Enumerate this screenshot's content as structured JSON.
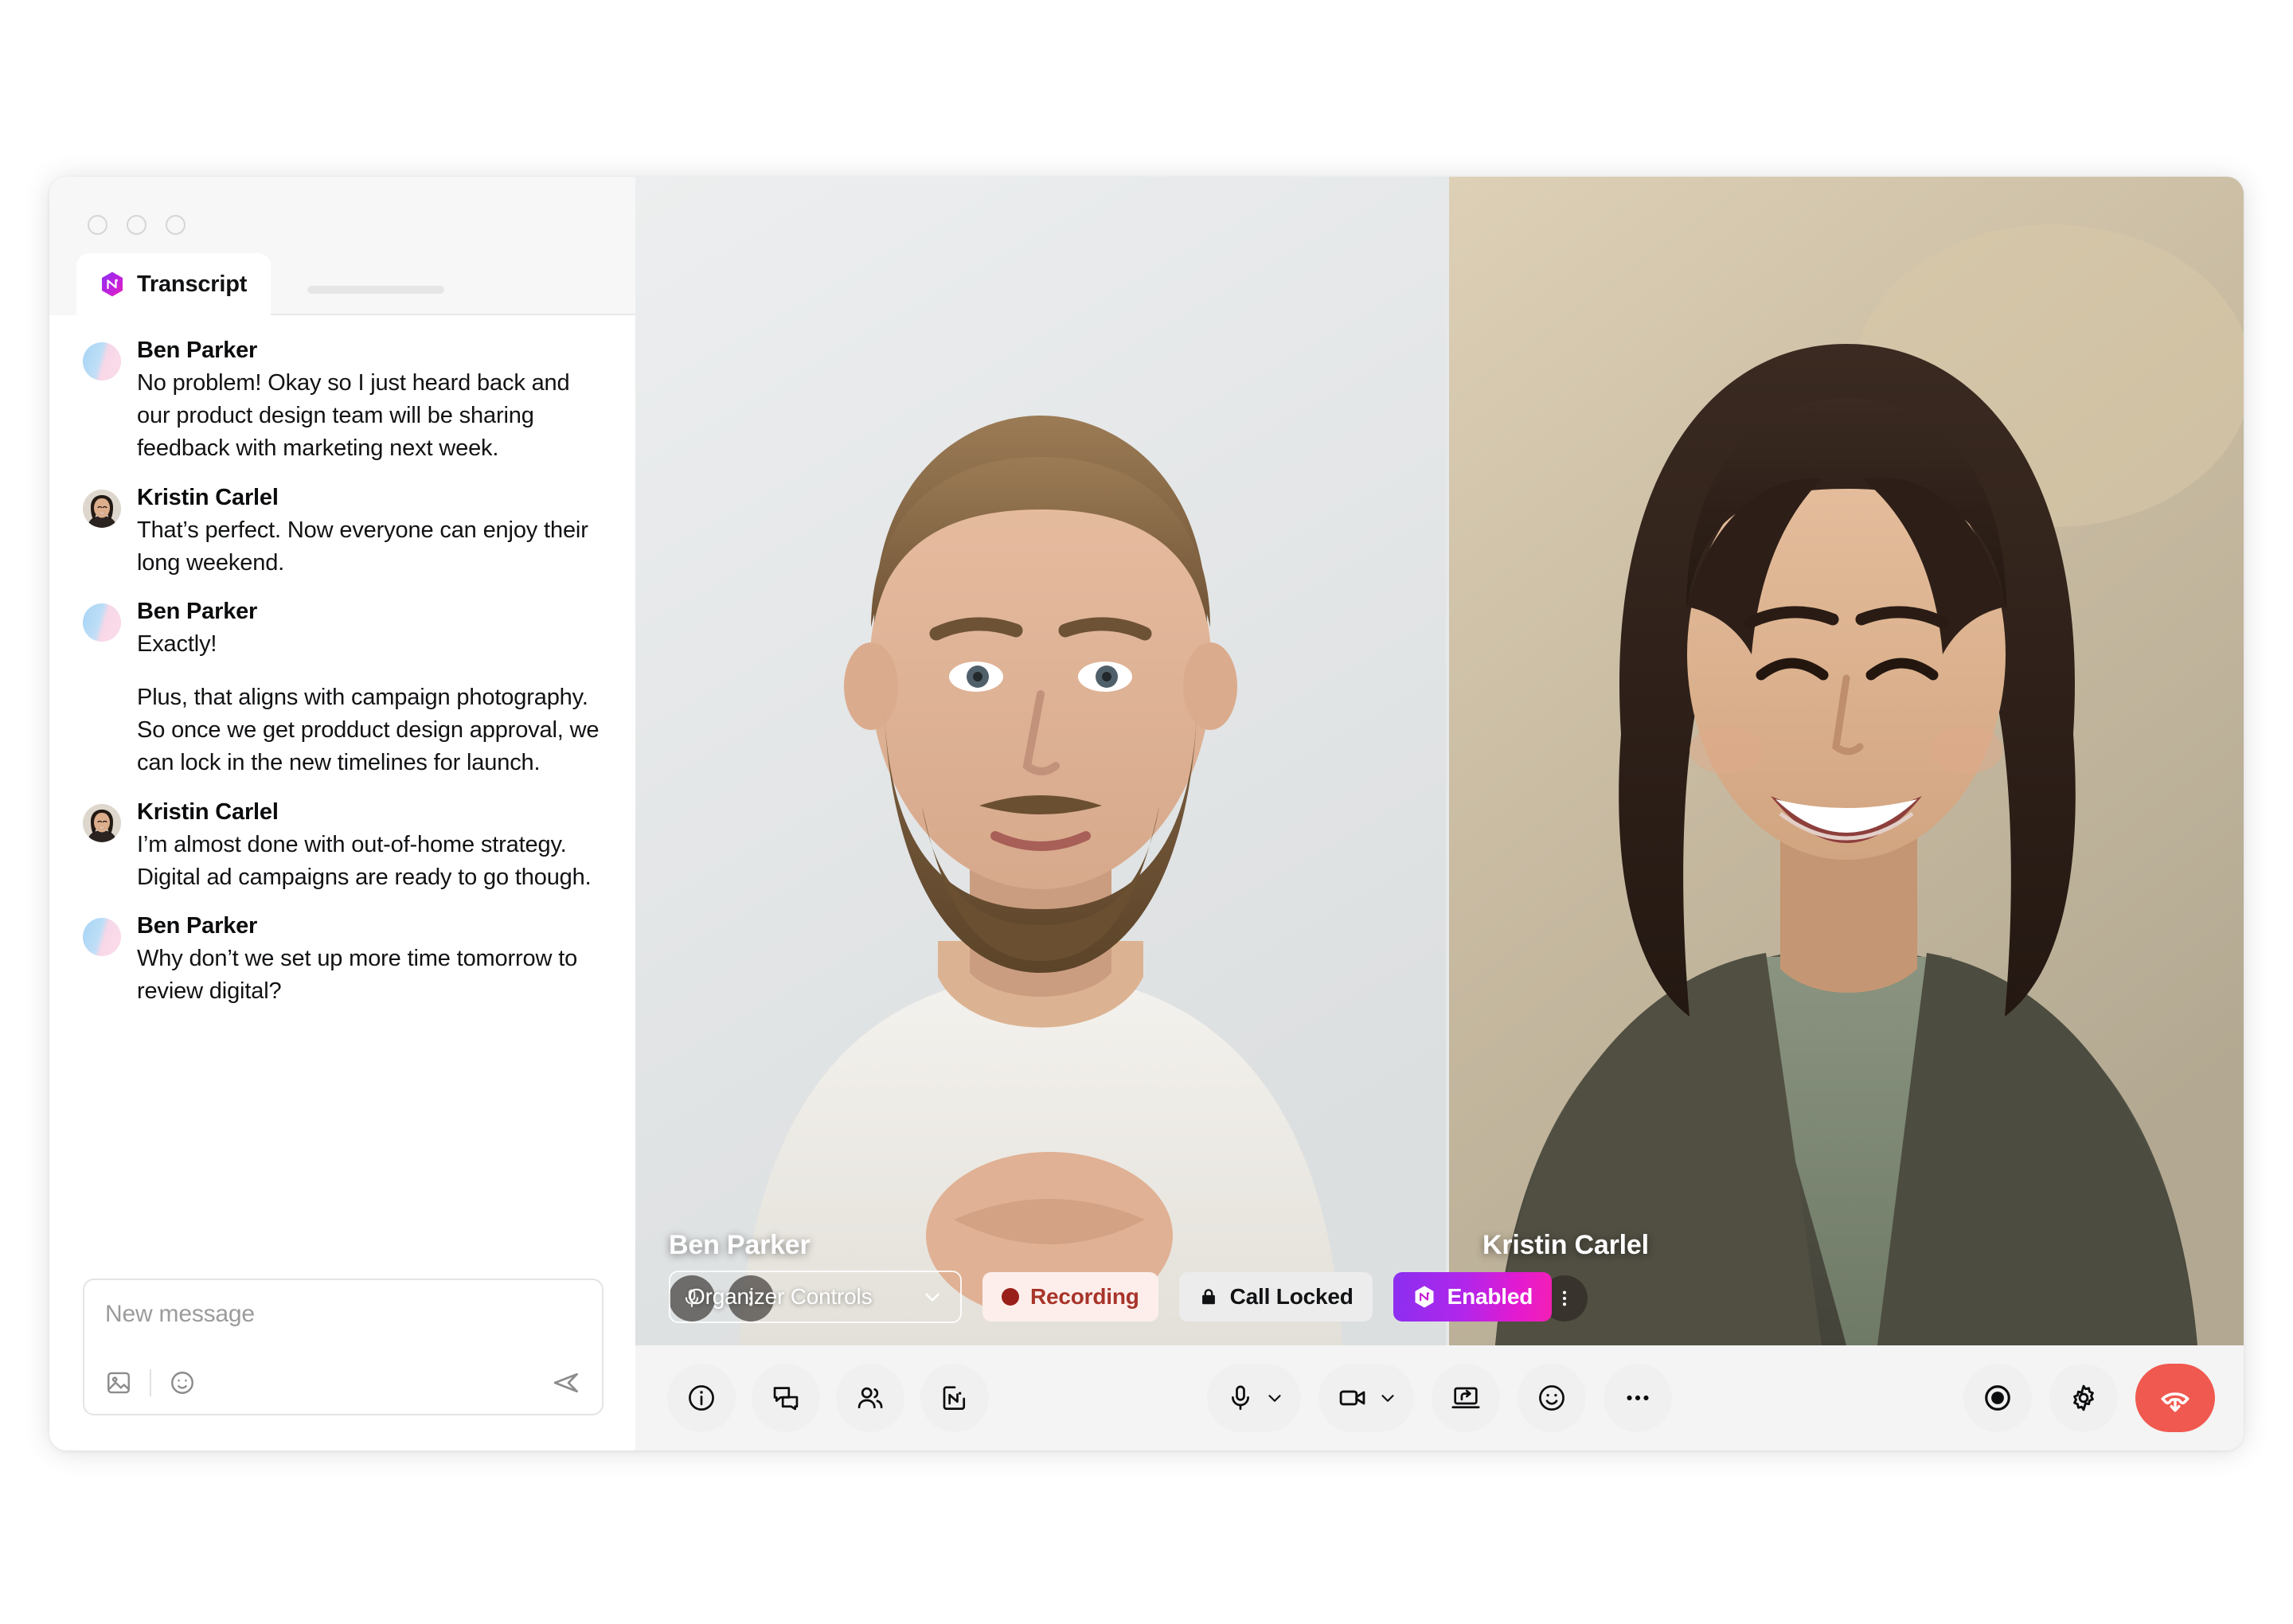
{
  "window": {
    "controls": [
      "close",
      "minimize",
      "maximize"
    ]
  },
  "sidebar": {
    "tab": {
      "label": "Transcript",
      "icon": "nyota-hex-icon"
    },
    "transcript": [
      {
        "author": "Ben Parker",
        "avatar": "gradient",
        "paragraphs": [
          "No problem! Okay so I just heard back and our product design team will be sharing feedback with marketing next week."
        ]
      },
      {
        "author": "Kristin Carlel",
        "avatar": "photo",
        "paragraphs": [
          "That’s perfect. Now everyone can enjoy their long weekend."
        ]
      },
      {
        "author": "Ben Parker",
        "avatar": "gradient",
        "paragraphs": [
          "Exactly!",
          "Plus, that aligns with campaign photography. So once we get prodduct design approval, we can lock in the new timelines for launch."
        ]
      },
      {
        "author": "Kristin Carlel",
        "avatar": "photo",
        "paragraphs": [
          "I’m almost done with out-of-home strategy. Digital ad campaigns are ready to go though."
        ]
      },
      {
        "author": "Ben Parker",
        "avatar": "gradient",
        "paragraphs": [
          "Why don’t we set up more time tomorrow to review digital?"
        ]
      }
    ],
    "composer": {
      "placeholder": "New message",
      "value": "",
      "attach_icon": "image-icon",
      "emoji_icon": "emoji-icon",
      "send_icon": "send-icon"
    }
  },
  "stage": {
    "participants": [
      {
        "name": "Ben Parker",
        "mic_icon": "microphone-icon",
        "more_icon": "more-vertical-icon"
      },
      {
        "name": "Kristin Carlel",
        "mic_icon": "microphone-icon",
        "more_icon": "more-vertical-icon"
      }
    ],
    "organizer": {
      "select_label": "Organizer Controls",
      "chevron_icon": "chevron-down-icon",
      "badges": [
        {
          "id": "recording",
          "label": "Recording",
          "icon": "record-dot-icon",
          "color": "#a8342a",
          "bg": "#fdeeeb"
        },
        {
          "id": "call-locked",
          "label": "Call Locked",
          "icon": "lock-icon",
          "color": "#111214",
          "bg": "#ececec"
        },
        {
          "id": "enabled",
          "label": "Enabled",
          "icon": "nyota-hex-icon",
          "color": "#ffffff",
          "bg": "#b126ea"
        }
      ]
    }
  },
  "controlbar": {
    "left": [
      {
        "id": "info",
        "icon": "info-icon"
      },
      {
        "id": "chat",
        "icon": "chat-bubbles-icon"
      },
      {
        "id": "participants",
        "icon": "people-icon"
      },
      {
        "id": "transcript-notes",
        "icon": "ai-notes-icon"
      }
    ],
    "center": [
      {
        "id": "microphone",
        "icon": "microphone-icon",
        "has_chevron": true
      },
      {
        "id": "camera",
        "icon": "video-camera-icon",
        "has_chevron": true
      },
      {
        "id": "share-screen",
        "icon": "share-screen-icon",
        "has_chevron": false
      },
      {
        "id": "reactions",
        "icon": "emoji-icon",
        "has_chevron": false
      },
      {
        "id": "more",
        "icon": "more-horizontal-icon",
        "has_chevron": false
      }
    ],
    "right": [
      {
        "id": "record",
        "icon": "record-circle-icon"
      },
      {
        "id": "settings",
        "icon": "gear-icon"
      },
      {
        "id": "end-call",
        "icon": "hangup-icon",
        "color": "#f0594f"
      }
    ]
  }
}
